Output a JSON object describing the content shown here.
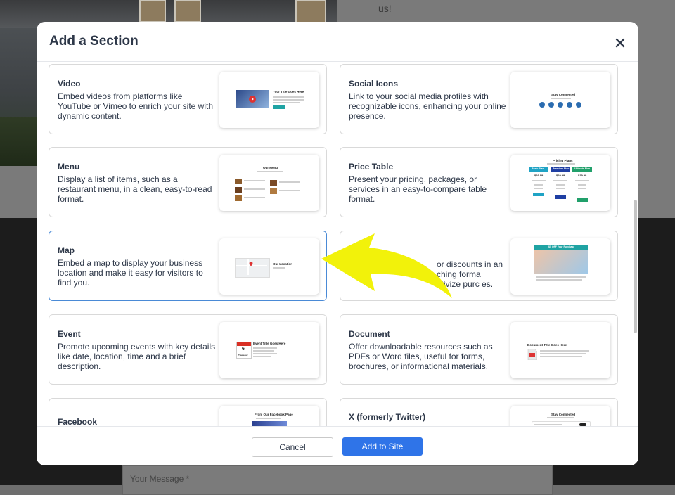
{
  "background": {
    "top_text": "us!",
    "message_placeholder": "Your Message *"
  },
  "modal": {
    "title": "Add a Section",
    "cancel_label": "Cancel",
    "add_label": "Add to Site"
  },
  "cards": [
    {
      "title": "Video",
      "description": "Embed videos from platforms like YouTube or Vimeo to enrich your site with dynamic content.",
      "preview": {
        "heading": "Your Title Goes Here"
      }
    },
    {
      "title": "Social Icons",
      "description": "Link to your social media profiles with recognizable icons, enhancing your online presence.",
      "preview": {
        "heading": "Stay Connected"
      }
    },
    {
      "title": "Menu",
      "description": "Display a list of items, such as a restaurant menu, in a clean, easy-to-read format.",
      "preview": {
        "heading": "Our Menu"
      }
    },
    {
      "title": "Price Table",
      "description": "Present your pricing, packages, or services in an easy-to-compare table format.",
      "preview": {
        "heading": "Pricing Plans",
        "plans": [
          "Basic Plan",
          "Premium Plan",
          "Ultimate Plan"
        ],
        "prices": [
          "$29.99",
          "$29.99",
          "$29.99"
        ]
      }
    },
    {
      "title": "Map",
      "description": "Embed a map to display your business location and make it easy for visitors to find you.",
      "preview": {
        "heading": "Our Location"
      }
    },
    {
      "title": "",
      "description": "or discounts in an ching forma ntivize purc es.",
      "preview": {
        "heading": "$5 OFF Your Purchase"
      }
    },
    {
      "title": "Event",
      "description": "Promote upcoming events with key details like date, location, time and a brief description.",
      "preview": {
        "heading": "Event Title Goes Here",
        "day": "6",
        "weekday": "Thursday"
      }
    },
    {
      "title": "Document",
      "description": "Offer downloadable resources such as PDFs or Word files, useful for forms, brochures, or informational materials.",
      "preview": {
        "heading": "Document Title Goes Here"
      }
    },
    {
      "title": "Facebook",
      "description": "",
      "preview": {
        "heading": "From Our Facebook Page"
      }
    },
    {
      "title": "X (formerly Twitter)",
      "description": "",
      "preview": {
        "heading": "Stay Connected"
      }
    }
  ],
  "colors": {
    "primary_button": "#2f74e8",
    "selected_border": "#4a8ad6",
    "arrow": "#f2f20a",
    "social_icon": "#2b6cb0",
    "plan_basic": "#1fa3c5",
    "plan_premium": "#1f3fa3",
    "plan_ultimate": "#21a06b"
  }
}
